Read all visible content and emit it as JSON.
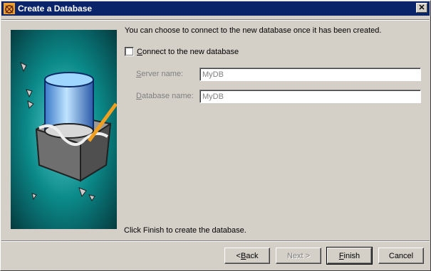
{
  "window": {
    "title": "Create a Database"
  },
  "intro_text": "You can choose to connect to the new database once it has been created.",
  "connect": {
    "label_prefix": "",
    "label_mnemonic": "C",
    "label_rest": "onnect to the new database",
    "checked": false
  },
  "server": {
    "label_mnemonic": "S",
    "label_rest": "erver name:",
    "value": "MyDB"
  },
  "database": {
    "label_mnemonic": "D",
    "label_rest": "atabase name:",
    "value": "MyDB"
  },
  "finish_note": "Click Finish to create the database.",
  "buttons": {
    "back": {
      "prefix": "< ",
      "mnemonic": "B",
      "rest": "ack"
    },
    "next": "Next >",
    "finish": {
      "mnemonic": "F",
      "rest": "inish"
    },
    "cancel": "Cancel"
  },
  "colors": {
    "titlebar": "#0a246a",
    "panel": "#d4d0c8",
    "art_bg": "#0b7f80"
  }
}
